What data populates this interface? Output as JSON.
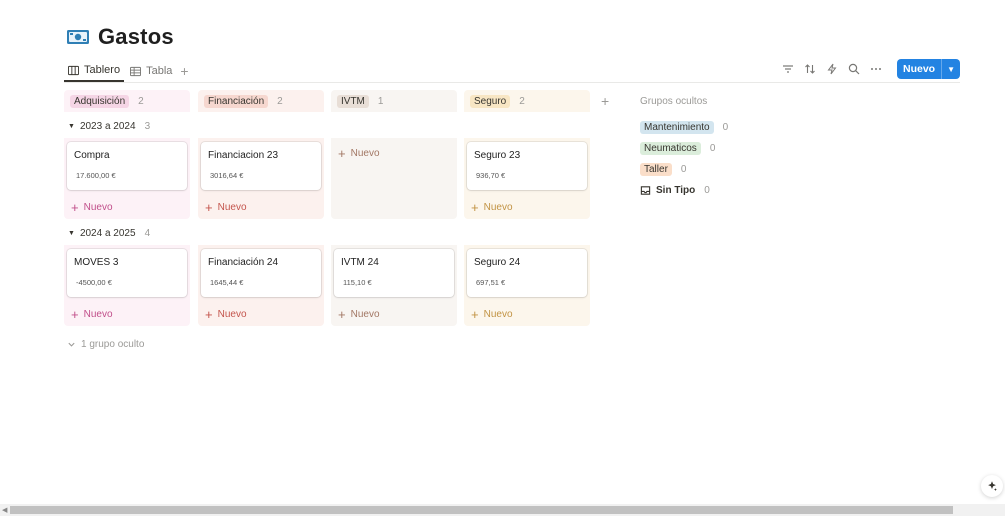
{
  "page": {
    "title": "Gastos",
    "title_icon": "money-bills-icon"
  },
  "views": [
    {
      "label": "Tablero",
      "icon": "board-icon",
      "active": true
    },
    {
      "label": "Tabla",
      "icon": "table-icon",
      "active": false
    }
  ],
  "toolbar": {
    "icons": [
      "filter-icon",
      "sort-icon",
      "automation-icon",
      "search-icon",
      "more-icon"
    ],
    "new_label": "Nuevo"
  },
  "columns": [
    {
      "label": "Adquisición",
      "count": "2",
      "bg": "#fdf2f7",
      "pill": "#f5d5e5"
    },
    {
      "label": "Financiación",
      "count": "2",
      "bg": "#fcf1ee",
      "pill": "#f6d7cf"
    },
    {
      "label": "IVTM",
      "count": "1",
      "bg": "#f8f5f2",
      "pill": "#e8ded6"
    },
    {
      "label": "Seguro",
      "count": "2",
      "bg": "#fcf6ec",
      "pill": "#f8e6c4"
    }
  ],
  "column_new_colors": [
    "#c14f8a",
    "#c4554d",
    "#a27764",
    "#c29343"
  ],
  "groups": [
    {
      "label": "2023 a 2024",
      "count": "3",
      "cells": [
        {
          "name": "Compra",
          "value": "17.600,00 €"
        },
        {
          "name": "Financiacion 23",
          "value": "3016,64 €"
        },
        null,
        {
          "name": "Seguro 23",
          "value": "936,70 €"
        }
      ]
    },
    {
      "label": "2024 a 2025",
      "count": "4",
      "cells": [
        {
          "name": "MOVES 3",
          "value": "-4500,00 €"
        },
        {
          "name": "Financiación 24",
          "value": "1645,44 €"
        },
        {
          "name": "IVTM 24",
          "value": "115,10 €"
        },
        {
          "name": "Seguro 24",
          "value": "697,51 €"
        }
      ]
    }
  ],
  "lane_new_label": "Nuevo",
  "hidden_groups": {
    "title": "Grupos ocultos",
    "items": [
      {
        "label": "Mantenimiento",
        "count": "0",
        "pill": "#d3e5ef"
      },
      {
        "label": "Neumaticos",
        "count": "0",
        "pill": "#dbeddb"
      },
      {
        "label": "Taller",
        "count": "0",
        "pill": "#fadec9"
      }
    ],
    "no_type": {
      "label": "Sin Tipo",
      "count": "0",
      "icon": "inbox-icon"
    }
  },
  "hidden_footer": "1 grupo oculto"
}
